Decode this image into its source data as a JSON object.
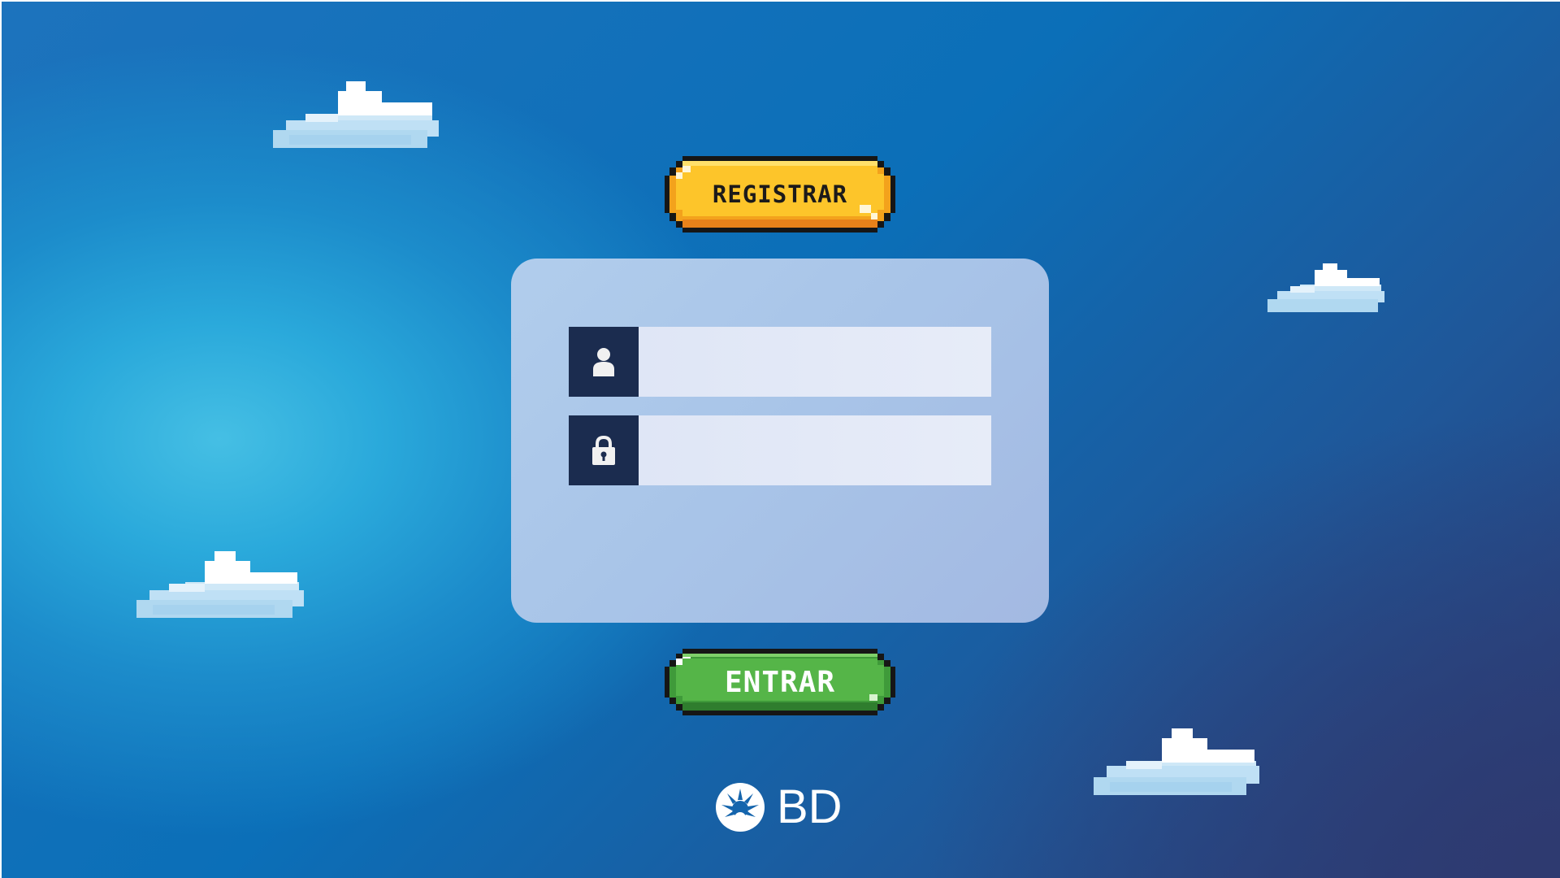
{
  "screen": {
    "buttons": {
      "register_label": "REGISTRAR",
      "enter_label": "ENTRAR"
    },
    "form": {
      "username": {
        "value": "",
        "placeholder": "",
        "icon": "user-icon"
      },
      "password": {
        "value": "",
        "placeholder": "",
        "icon": "lock-icon"
      }
    },
    "logo": {
      "text": "BD",
      "icon": "bd-logo-mark"
    }
  },
  "colors": {
    "register_button": "#f7b821",
    "enter_button": "#4caf43",
    "field_icon_box": "#1b2c4f",
    "panel": "#aac6ea"
  }
}
